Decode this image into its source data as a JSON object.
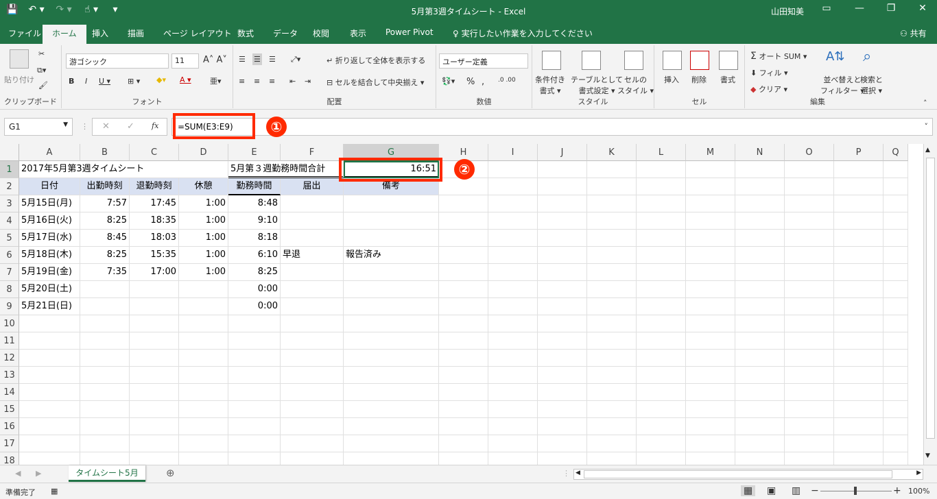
{
  "titlebar": {
    "title": "5月第3週タイムシート  -  Excel",
    "user": "山田知美",
    "qat": [
      "💾",
      "↶ ▾",
      "↷ ▾",
      "☝ ▾",
      "▾"
    ]
  },
  "tabs": [
    "ファイル",
    "ホーム",
    "挿入",
    "描画",
    "ページ レイアウト",
    "数式",
    "データ",
    "校閲",
    "表示",
    "Power Pivot",
    "♀ 実行したい作業を入力してください",
    "⚇ 共有"
  ],
  "ribbon": {
    "clipboard": {
      "paste": "貼り付け",
      "label": "クリップボード"
    },
    "font": {
      "name": "游ゴシック",
      "size": "11",
      "label": "フォント"
    },
    "alignment": {
      "wrap": "折り返して全体を表示する",
      "merge": "セルを結合して中央揃え",
      "label": "配置"
    },
    "number": {
      "format": "ユーザー定義",
      "label": "数値"
    },
    "styles": {
      "conditional": "条件付き\n書式 ▾",
      "table": "テーブルとして\n書式設定 ▾",
      "cell": "セルの\nスタイル ▾",
      "label": "スタイル"
    },
    "cells": {
      "insert": "挿入",
      "delete": "削除",
      "format": "書式",
      "label": "セル"
    },
    "editing": {
      "autosum": "オート SUM",
      "fill": "フィル ▾",
      "clear": "クリア ▾",
      "sort": "並べ替えと\nフィルター ▾",
      "find": "検索と\n選択 ▾",
      "label": "編集"
    }
  },
  "formula_bar": {
    "namebox": "G1",
    "formula": "=SUM(E3:E9)",
    "fx": "fx"
  },
  "annotations": {
    "one": "①",
    "two": "②"
  },
  "columns": [
    "A",
    "B",
    "C",
    "D",
    "E",
    "F",
    "G",
    "H",
    "I",
    "J",
    "K",
    "L",
    "M",
    "N",
    "O",
    "P",
    "Q"
  ],
  "rows": [
    "1",
    "2",
    "3",
    "4",
    "5",
    "6",
    "7",
    "8",
    "9",
    "10",
    "11",
    "12",
    "13",
    "14",
    "15",
    "16",
    "17",
    "18"
  ],
  "sheet": {
    "A1": "2017年5月第3週タイムシート",
    "E1": "5月第３週勤務時間合計",
    "G1": "16:51",
    "headers": [
      "日付",
      "出勤時刻",
      "退勤時刻",
      "休憩",
      "勤務時間",
      "届出",
      "備考"
    ],
    "data": [
      [
        "5月15日(月)",
        "7:57",
        "17:45",
        "1:00",
        "8:48",
        "",
        ""
      ],
      [
        "5月16日(火)",
        "8:25",
        "18:35",
        "1:00",
        "9:10",
        "",
        ""
      ],
      [
        "5月17日(水)",
        "8:45",
        "18:03",
        "1:00",
        "8:18",
        "",
        ""
      ],
      [
        "5月18日(木)",
        "8:25",
        "15:35",
        "1:00",
        "6:10",
        "早退",
        "報告済み"
      ],
      [
        "5月19日(金)",
        "7:35",
        "17:00",
        "1:00",
        "8:25",
        "",
        ""
      ],
      [
        "5月20日(土)",
        "",
        "",
        "",
        "0:00",
        "",
        ""
      ],
      [
        "5月21日(日)",
        "",
        "",
        "",
        "0:00",
        "",
        ""
      ]
    ]
  },
  "sheet_tab": "タイムシート5月",
  "status": {
    "ready": "準備完了",
    "zoom": "100%"
  }
}
